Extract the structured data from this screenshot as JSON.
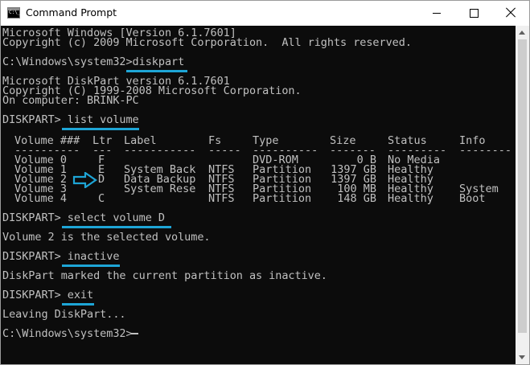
{
  "window": {
    "title": "Command Prompt",
    "icon": "cmd-icon",
    "controls": [
      "minimize-icon",
      "maximize-icon",
      "close-icon"
    ]
  },
  "console": {
    "lines": [
      "Microsoft Windows [Version 6.1.7601]",
      "Copyright (c) 2009 Microsoft Corporation.  All rights reserved.",
      "",
      "C:\\Windows\\system32>diskpart",
      "",
      "Microsoft DiskPart version 6.1.7601",
      "Copyright (C) 1999-2008 Microsoft Corporation.",
      "On computer: BRINK-PC",
      "",
      "DISKPART> list volume",
      "",
      "Volume 2 is the selected volume.",
      "",
      "DISKPART> inactive",
      "",
      "DiskPart marked the current partition as inactive.",
      "",
      "DISKPART> exit",
      "",
      "Leaving DiskPart...",
      "",
      "C:\\Windows\\system32>"
    ],
    "select_command_line": "DISKPART> select volume D",
    "highlighted_commands": [
      "diskpart",
      "list volume",
      "select volume D",
      "inactive",
      "exit"
    ],
    "highlight_color": "#1ea5d6",
    "text_color": "#c0c0c0",
    "background_color": "#0c0c0c"
  },
  "volume_table": {
    "columns": [
      "Volume ###",
      "Ltr",
      "Label",
      "Fs",
      "Type",
      "Size",
      "Status",
      "Info"
    ],
    "separators": [
      "----------",
      "---",
      "-----------",
      "-----",
      "----------",
      "-------",
      "---------",
      "--------"
    ],
    "rows": [
      [
        "Volume 0",
        "F",
        "",
        "",
        "DVD-ROM",
        "0 B",
        "No Media",
        ""
      ],
      [
        "Volume 1",
        "E",
        "System Back",
        "NTFS",
        "Partition",
        "1397 GB",
        "Healthy",
        ""
      ],
      [
        "Volume 2",
        "D",
        "Data Backup",
        "NTFS",
        "Partition",
        "1397 GB",
        "Healthy",
        ""
      ],
      [
        "Volume 3",
        "",
        "System Rese",
        "NTFS",
        "Partition",
        "100 MB",
        "Healthy",
        "System"
      ],
      [
        "Volume 4",
        "C",
        "",
        "NTFS",
        "Partition",
        "148 GB",
        "Healthy",
        "Boot"
      ]
    ],
    "selected_row_marker": "arrow-right-icon"
  }
}
